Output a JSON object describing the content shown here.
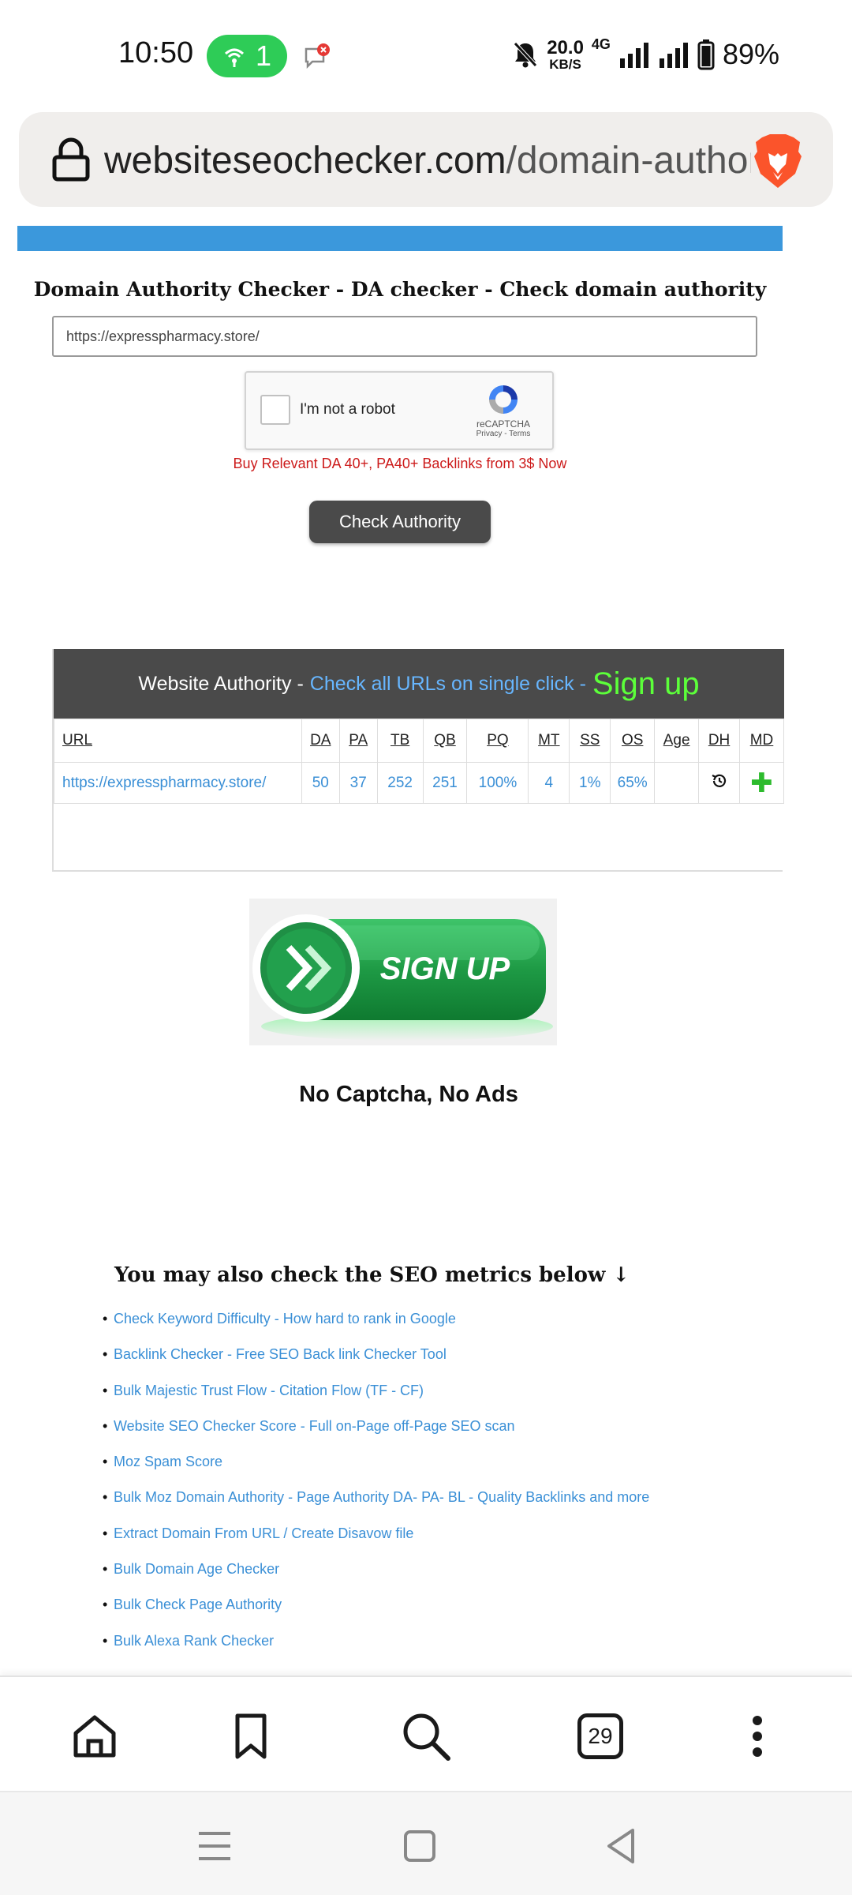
{
  "status_bar": {
    "time": "10:50",
    "hotspot_count": "1",
    "speed_value": "20.0",
    "speed_unit": "KB/S",
    "network": "4G",
    "battery": "89%"
  },
  "browser": {
    "url_domain": "websiteseochecker.com",
    "url_path": "/domain-authority-checker",
    "tab_count": "29"
  },
  "checker": {
    "title": "Domain Authority Checker - DA checker - Check domain authority",
    "input_value": "https://expresspharmacy.store/",
    "captcha_label": "I'm not a robot",
    "captcha_brand": "reCAPTCHA",
    "captcha_links": "Privacy - Terms",
    "promo": "Buy Relevant DA 40+, PA40+ Backlinks from 3$ Now",
    "button": "Check Authority"
  },
  "authority": {
    "heading_white": "Website Authority -",
    "heading_link": "Check all URLs on single click -",
    "heading_signup": "Sign up",
    "columns": [
      "URL",
      "DA",
      "PA",
      "TB",
      "QB",
      "PQ",
      "MT",
      "SS",
      "OS",
      "Age",
      "DH",
      "MD"
    ],
    "row": {
      "url": "https://expresspharmacy.store/",
      "da": "50",
      "pa": "37",
      "tb": "252",
      "qb": "251",
      "pq": "100%",
      "mt": "4",
      "ss": "1%",
      "os": "65%",
      "age": ""
    }
  },
  "signup_banner": {
    "text": "SIGN UP",
    "caption": "No Captcha, No Ads"
  },
  "seo": {
    "heading": "You may also check the SEO metrics below ↓",
    "links": [
      "Check Keyword Difficulty - How hard to rank in Google",
      "Backlink Checker - Free SEO Back link Checker Tool",
      "Bulk Majestic Trust Flow - Citation Flow (TF - CF)",
      "Website SEO Checker Score - Full on-Page off-Page SEO scan",
      "Moz Spam Score",
      "Bulk Moz Domain Authority - Page Authority DA- PA- BL - Quality Backlinks and more",
      "Extract Domain From URL / Create Disavow file",
      "Bulk Domain Age Checker",
      "Bulk Check Page Authority",
      "Bulk Alexa Rank Checker"
    ]
  },
  "colors": {
    "band_blue": "#3b98dc",
    "link_blue": "#3a8fd6",
    "promo_red": "#cc1a1a",
    "signup_green": "#5cff3a",
    "hotspot_green": "#2ecc57",
    "brave_orange": "#fb542b"
  },
  "icons": [
    "wifi-hotspot-icon",
    "notification-icon",
    "mute-icon",
    "signal-icon",
    "battery-icon",
    "lock-icon",
    "brave-logo-icon",
    "recaptcha-icon",
    "history-icon",
    "plus-icon",
    "home-icon",
    "bookmark-icon",
    "search-icon",
    "menu-icon",
    "back-icon"
  ]
}
